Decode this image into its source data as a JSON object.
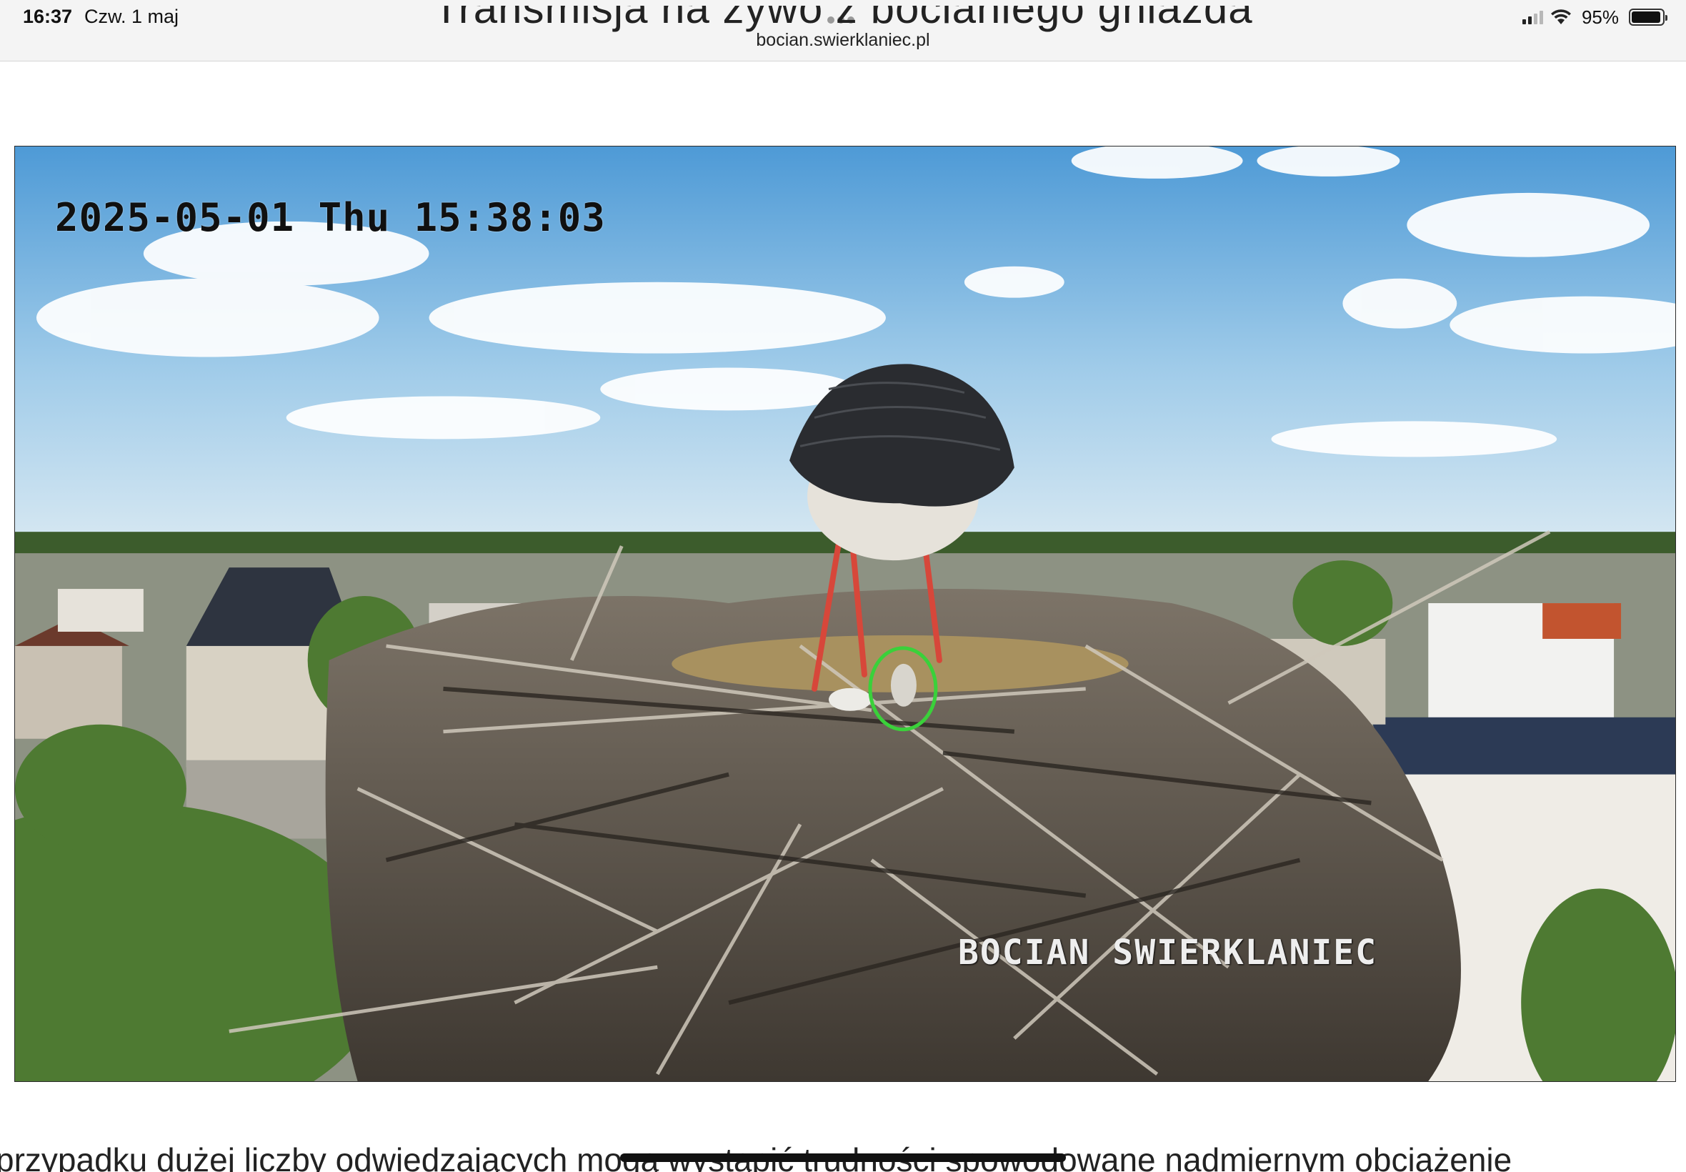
{
  "status_bar": {
    "time": "16:37",
    "date": "Czw. 1 maj",
    "battery": "95%",
    "battery_level": 0.95
  },
  "browser": {
    "address": "bocian.swierklaniec.pl"
  },
  "page": {
    "heading_partial": "Transmisja na żywo z bocianiego gniazda",
    "body_text_partial": "przypadku dużej liczby odwiedzających mogą wystąpić trudności spowodowane nadmiernym obciążenie"
  },
  "stream": {
    "timestamp": "2025-05-01 Thu 15:38:03",
    "camera_name": "BOCIAN SWIERKLANIEC"
  },
  "icons": [
    "signal-icon",
    "wifi-icon",
    "battery-icon",
    "tab-dots-icon"
  ],
  "colors": {
    "sky": "#6aa9d6",
    "highlight_circle": "#3ad13a",
    "status_bar_bg": "#f4f4f4"
  }
}
